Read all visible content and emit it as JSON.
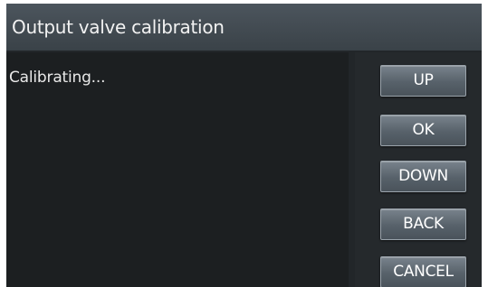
{
  "dialog": {
    "title": "Output valve calibration",
    "message": "Calibrating..."
  },
  "buttons": {
    "up": "UP",
    "ok": "OK",
    "down": "DOWN",
    "back": "BACK",
    "cancel": "CANCEL"
  }
}
